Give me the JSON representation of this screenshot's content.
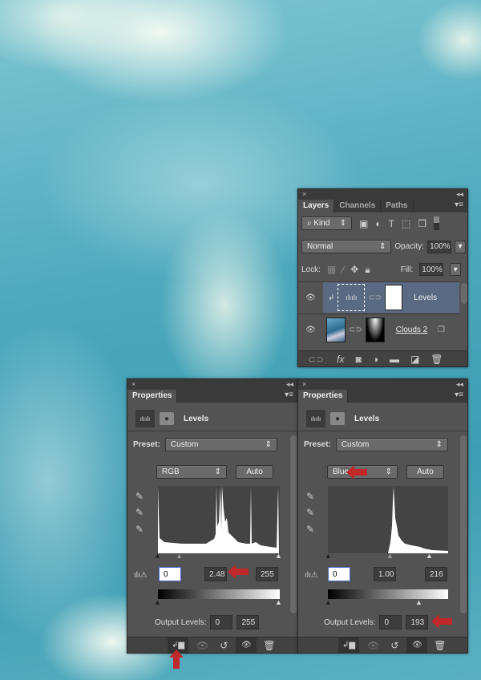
{
  "layers_panel": {
    "close": "×",
    "collapse": "◂◂",
    "menu": "▾≡",
    "tabs": [
      "Layers",
      "Channels",
      "Paths"
    ],
    "filter_kind": "Kind",
    "blend_mode": "Normal",
    "opacity_label": "Opacity:",
    "opacity": "100%",
    "lock_label": "Lock:",
    "fill_label": "Fill:",
    "fill": "100%",
    "layers": [
      {
        "name": "Levels",
        "selected": true
      },
      {
        "name": "Clouds 2",
        "selected": false
      }
    ]
  },
  "properties_left": {
    "close": "×",
    "collapse": "◂◂",
    "menu": "▾≡",
    "tab": "Properties",
    "title": "Levels",
    "preset_label": "Preset:",
    "preset": "Custom",
    "channel": "RGB",
    "auto": "Auto",
    "input_black": "0",
    "input_gamma": "2.48",
    "input_white": "255",
    "output_label": "Output Levels:",
    "output_black": "0",
    "output_white": "255"
  },
  "properties_right": {
    "close": "×",
    "collapse": "◂◂",
    "menu": "▾≡",
    "tab": "Properties",
    "title": "Levels",
    "preset_label": "Preset:",
    "preset": "Custom",
    "channel": "Blue",
    "auto": "Auto",
    "input_black": "0",
    "input_gamma": "1.00",
    "input_white": "216",
    "output_label": "Output Levels:",
    "output_black": "0",
    "output_white": "193"
  },
  "colors": {
    "annotation_arrow": "#c0282a",
    "selected_layer": "#5a6a82",
    "panel": "#535353"
  }
}
